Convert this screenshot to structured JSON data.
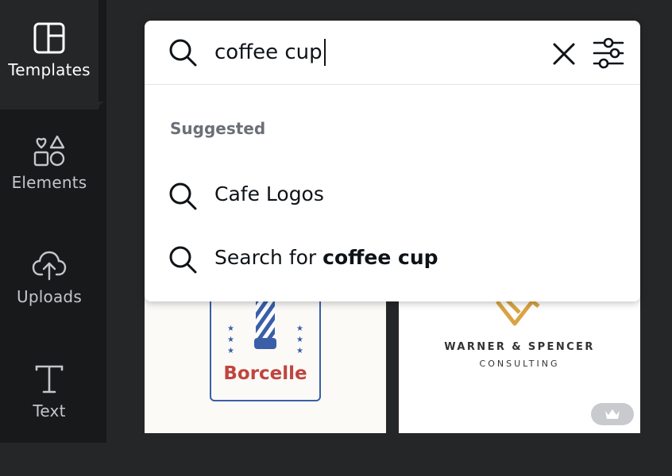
{
  "sidebar": {
    "items": [
      {
        "label": "Templates",
        "icon": "templates-icon",
        "active": true
      },
      {
        "label": "Elements",
        "icon": "elements-icon"
      },
      {
        "label": "Uploads",
        "icon": "uploads-icon"
      },
      {
        "label": "Text",
        "icon": "text-icon"
      }
    ]
  },
  "search": {
    "value": "coffee cup",
    "clear_icon": "close-icon",
    "filter_icon": "filter-sliders-icon"
  },
  "suggestions": {
    "heading": "Suggested",
    "items": [
      {
        "text": "Cafe Logos"
      },
      {
        "prefix": "Search for ",
        "query": "coffee cup"
      }
    ]
  },
  "cards": [
    {
      "brand": "Borcelle"
    },
    {
      "line1": "WARNER & SPENCER",
      "line2": "CONSULTING",
      "badge_icon": "crown-icon"
    }
  ],
  "colors": {
    "rail_bg": "#18191b",
    "panel_bg": "#252627",
    "accent_red": "#c0453f",
    "accent_blue": "#3a5fa8",
    "gold": "#d9a441"
  }
}
